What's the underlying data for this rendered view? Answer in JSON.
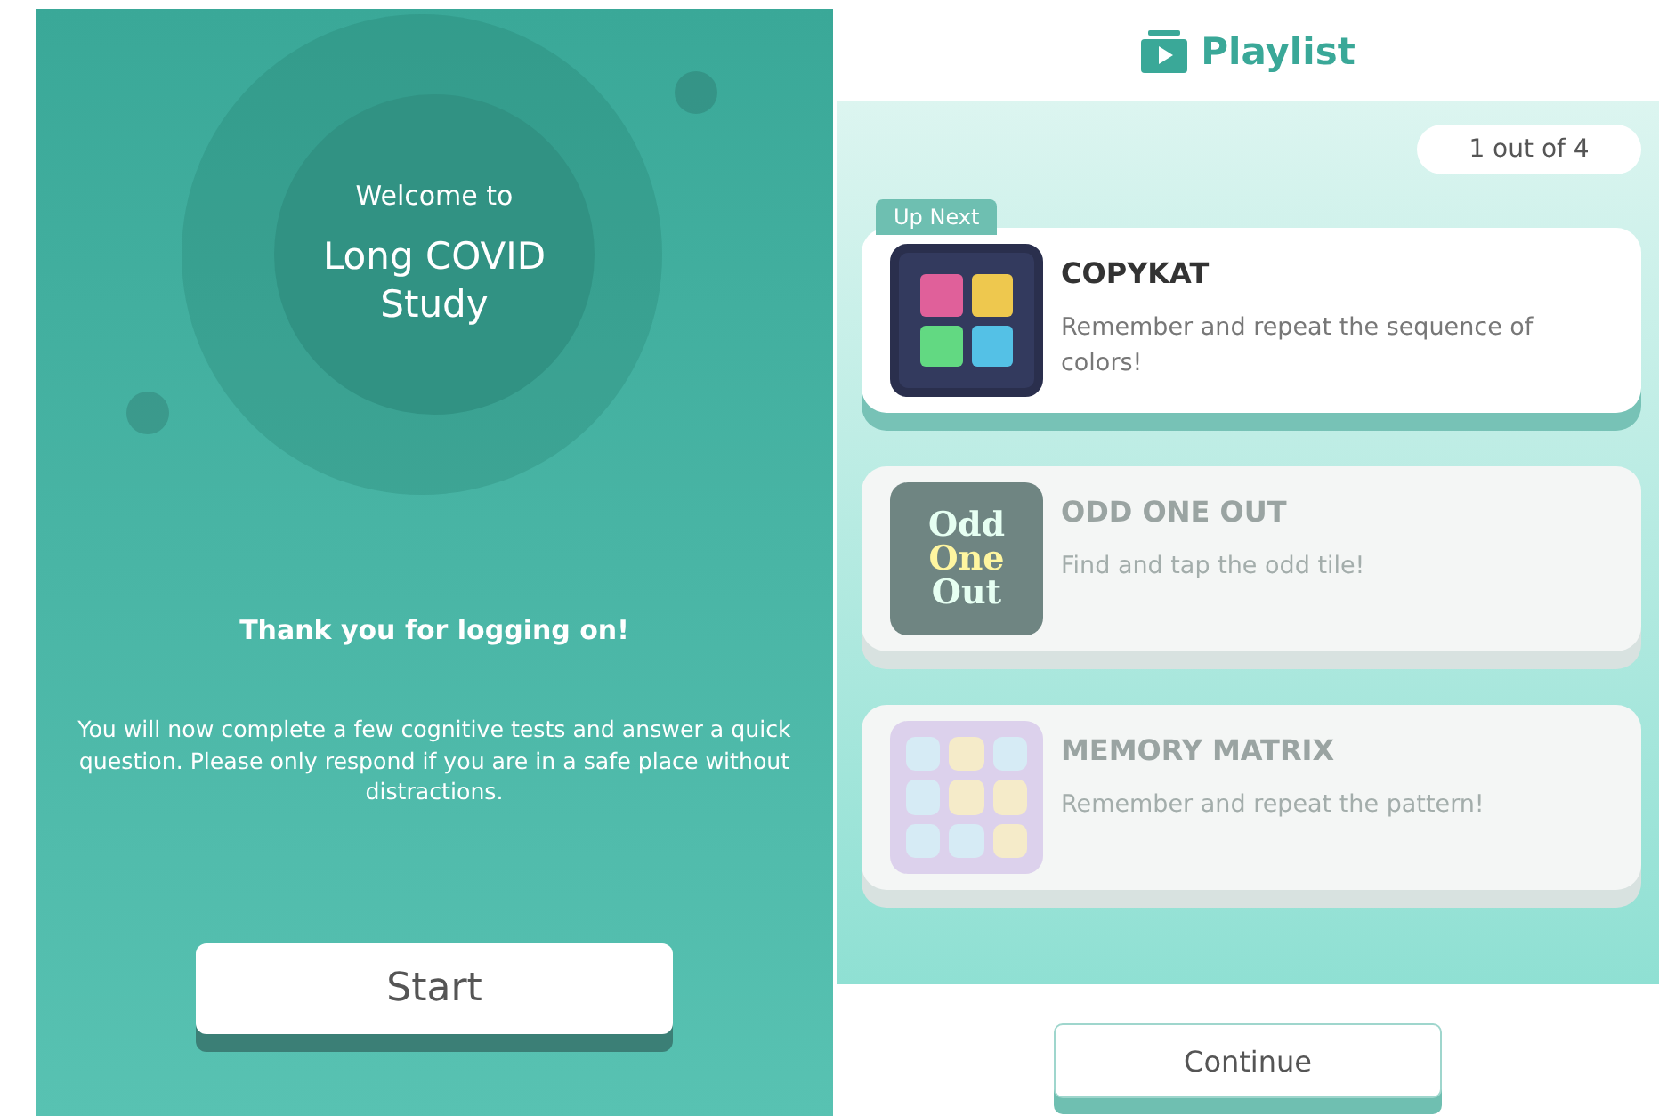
{
  "welcome_screen": {
    "greeting": "Welcome to",
    "title": "Long COVID Study",
    "thanks": "Thank you for logging on!",
    "message": "You will now complete a few cognitive tests and answer a quick question. Please only respond if you are in a safe place without distractions.",
    "button": "Start"
  },
  "playlist_screen": {
    "title": "Playlist",
    "counter": "1 out of 4",
    "games": [
      {
        "kind": "color-grid",
        "name": "COPYKAT",
        "description": "Remember and repeat the sequence of colors!",
        "badge": "Up Next",
        "disabled": false
      },
      {
        "kind": "odd-logo",
        "name": "ODD ONE OUT",
        "description": "Find and tap the odd tile!",
        "icon_text": [
          "Odd",
          "One",
          "Out"
        ],
        "disabled": true
      },
      {
        "kind": "matrix",
        "name": "MEMORY MATRIX",
        "description": "Remember and repeat the pattern!",
        "disabled": true
      }
    ],
    "button": "Continue"
  }
}
